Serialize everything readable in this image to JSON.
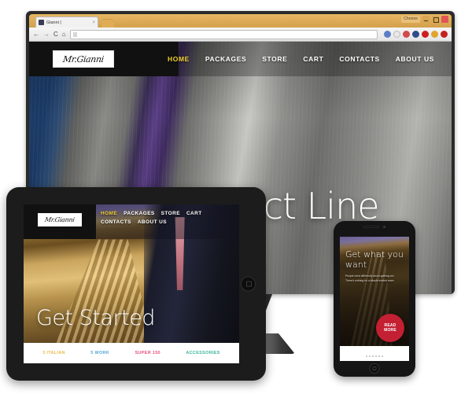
{
  "browser": {
    "tab": {
      "title": "Gianni |",
      "favicon": "page-favicon",
      "close_label": "×"
    },
    "new_tab_label": "+",
    "window_controls": {
      "menu_label": "Chrome",
      "minimize": "–",
      "maximize": "□",
      "close": "×"
    },
    "toolbar": {
      "back": "←",
      "forward": "→",
      "reload": "C",
      "home": "⌂",
      "url_value": "",
      "url_placeholder": "",
      "extension_icons": [
        "shield-icon",
        "star-icon",
        "translate-icon",
        "pocket-icon",
        "opera-icon",
        "download-icon",
        "block-icon"
      ]
    }
  },
  "desktop_site": {
    "logo_text": "Mr.Gianni",
    "nav": [
      {
        "label": "HOME",
        "active": true
      },
      {
        "label": "PACKAGES",
        "active": false
      },
      {
        "label": "STORE",
        "active": false
      },
      {
        "label": "CART",
        "active": false
      },
      {
        "label": "CONTACTS",
        "active": false
      },
      {
        "label": "ABOUT US",
        "active": false
      }
    ],
    "hero_title": "Super Product Line"
  },
  "tablet_site": {
    "logo_text": "Mr.Gianni",
    "nav": [
      {
        "label": "HOME",
        "active": true
      },
      {
        "label": "PACKAGES",
        "active": false
      },
      {
        "label": "STORE",
        "active": false
      },
      {
        "label": "CART",
        "active": false
      },
      {
        "label": "CONTACTS",
        "active": false
      },
      {
        "label": "ABOUT US",
        "active": false
      }
    ],
    "hero_title": "Get Started",
    "categories": [
      {
        "label": "3 ITALIAN",
        "color": "#e8bb4a"
      },
      {
        "label": "5 WORK",
        "color": "#5aa8d8"
      },
      {
        "label": "SUPER 150",
        "color": "#e8537f"
      },
      {
        "label": "ACCESSORIES",
        "color": "#3fb7a0"
      }
    ]
  },
  "phone_site": {
    "hero_title": "Get what you want",
    "body_text": "People mind differently about gaining out. There's nothing for a simple indeed more.",
    "read_more_line1": "READ",
    "read_more_line2": "MORE",
    "accent_color": "#c32033"
  },
  "colors": {
    "browser_chrome": "#d9a84e",
    "nav_active": "#f2d22e",
    "monitor_bezel": "#2b2b2b",
    "device_body": "#1c1c1c"
  }
}
